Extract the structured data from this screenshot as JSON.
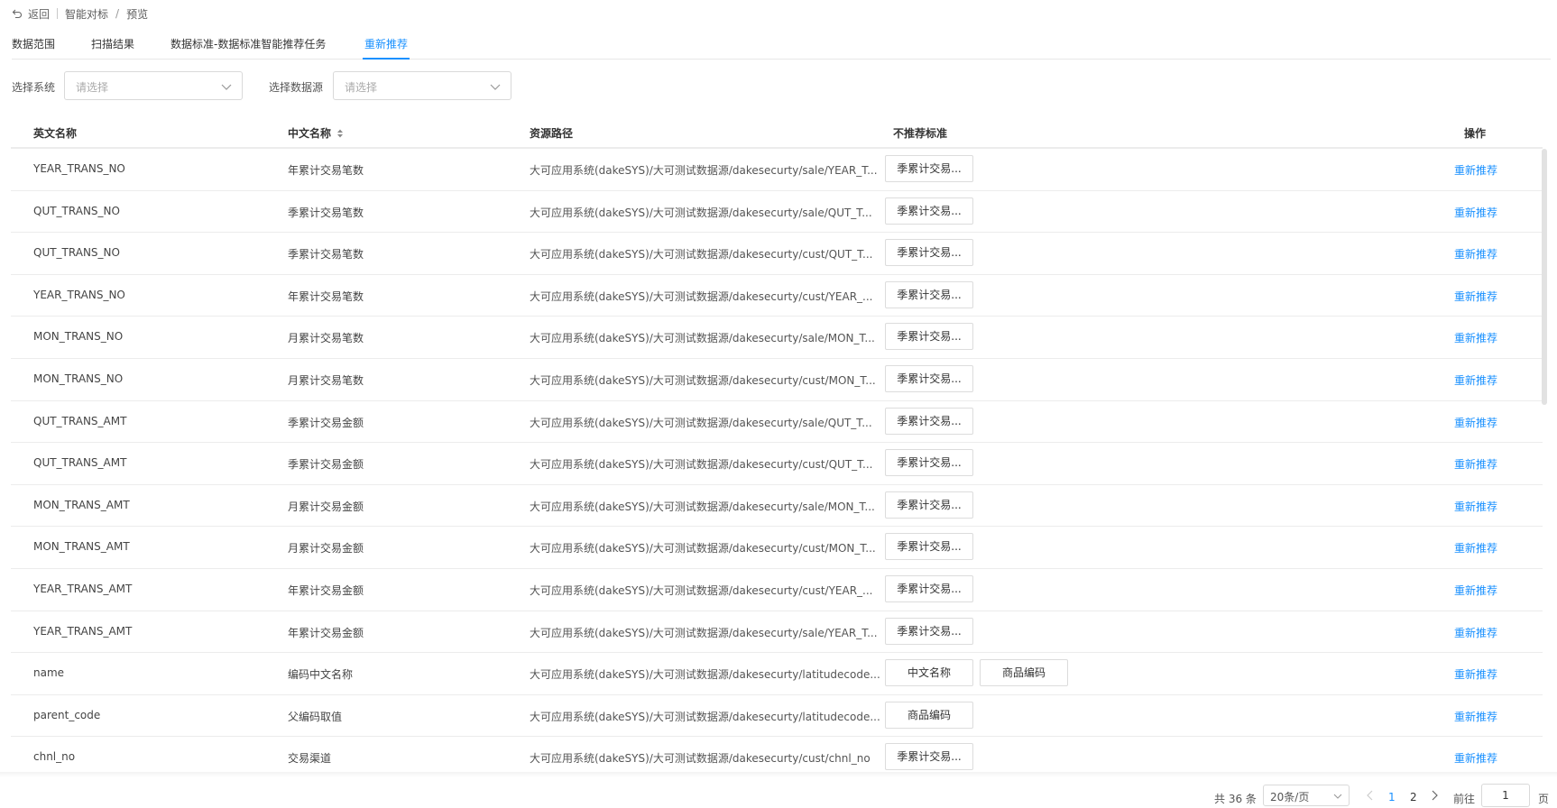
{
  "breadcrumb": {
    "back_label": "返回",
    "items": [
      "智能对标",
      "预览"
    ],
    "separator": "/"
  },
  "tabs": [
    {
      "label": "数据范围",
      "active": false
    },
    {
      "label": "扫描结果",
      "active": false
    },
    {
      "label": "数据标准-数据标准智能推荐任务",
      "active": false
    },
    {
      "label": "重新推荐",
      "active": true
    }
  ],
  "filters": {
    "system": {
      "label": "选择系统",
      "placeholder": "请选择"
    },
    "datasource": {
      "label": "选择数据源",
      "placeholder": "请选择"
    }
  },
  "table": {
    "columns": [
      "英文名称",
      "中文名称",
      "资源路径",
      "不推荐标准",
      "操作"
    ],
    "rows": [
      {
        "en": "YEAR_TRANS_NO",
        "cn": "年累计交易笔数",
        "path": "大可应用系统(dakeSYS)/大可测试数据源/dakesecurty/sale/YEAR_T...",
        "tags": [
          "季累计交易..."
        ],
        "op": "重新推荐"
      },
      {
        "en": "QUT_TRANS_NO",
        "cn": "季累计交易笔数",
        "path": "大可应用系统(dakeSYS)/大可测试数据源/dakesecurty/sale/QUT_T...",
        "tags": [
          "季累计交易..."
        ],
        "op": "重新推荐"
      },
      {
        "en": "QUT_TRANS_NO",
        "cn": "季累计交易笔数",
        "path": "大可应用系统(dakeSYS)/大可测试数据源/dakesecurty/cust/QUT_T...",
        "tags": [
          "季累计交易..."
        ],
        "op": "重新推荐"
      },
      {
        "en": "YEAR_TRANS_NO",
        "cn": "年累计交易笔数",
        "path": "大可应用系统(dakeSYS)/大可测试数据源/dakesecurty/cust/YEAR_...",
        "tags": [
          "季累计交易..."
        ],
        "op": "重新推荐"
      },
      {
        "en": "MON_TRANS_NO",
        "cn": "月累计交易笔数",
        "path": "大可应用系统(dakeSYS)/大可测试数据源/dakesecurty/sale/MON_T...",
        "tags": [
          "季累计交易..."
        ],
        "op": "重新推荐"
      },
      {
        "en": "MON_TRANS_NO",
        "cn": "月累计交易笔数",
        "path": "大可应用系统(dakeSYS)/大可测试数据源/dakesecurty/cust/MON_T...",
        "tags": [
          "季累计交易..."
        ],
        "op": "重新推荐"
      },
      {
        "en": "QUT_TRANS_AMT",
        "cn": "季累计交易金额",
        "path": "大可应用系统(dakeSYS)/大可测试数据源/dakesecurty/sale/QUT_T...",
        "tags": [
          "季累计交易..."
        ],
        "op": "重新推荐"
      },
      {
        "en": "QUT_TRANS_AMT",
        "cn": "季累计交易金额",
        "path": "大可应用系统(dakeSYS)/大可测试数据源/dakesecurty/cust/QUT_T...",
        "tags": [
          "季累计交易..."
        ],
        "op": "重新推荐"
      },
      {
        "en": "MON_TRANS_AMT",
        "cn": "月累计交易金额",
        "path": "大可应用系统(dakeSYS)/大可测试数据源/dakesecurty/sale/MON_T...",
        "tags": [
          "季累计交易..."
        ],
        "op": "重新推荐"
      },
      {
        "en": "MON_TRANS_AMT",
        "cn": "月累计交易金额",
        "path": "大可应用系统(dakeSYS)/大可测试数据源/dakesecurty/cust/MON_T...",
        "tags": [
          "季累计交易..."
        ],
        "op": "重新推荐"
      },
      {
        "en": "YEAR_TRANS_AMT",
        "cn": "年累计交易金额",
        "path": "大可应用系统(dakeSYS)/大可测试数据源/dakesecurty/cust/YEAR_...",
        "tags": [
          "季累计交易..."
        ],
        "op": "重新推荐"
      },
      {
        "en": "YEAR_TRANS_AMT",
        "cn": "年累计交易金额",
        "path": "大可应用系统(dakeSYS)/大可测试数据源/dakesecurty/sale/YEAR_T...",
        "tags": [
          "季累计交易..."
        ],
        "op": "重新推荐"
      },
      {
        "en": "name",
        "cn": "编码中文名称",
        "path": "大可应用系统(dakeSYS)/大可测试数据源/dakesecurty/latitudecode...",
        "tags": [
          "中文名称",
          "商品编码"
        ],
        "op": "重新推荐"
      },
      {
        "en": "parent_code",
        "cn": "父编码取值",
        "path": "大可应用系统(dakeSYS)/大可测试数据源/dakesecurty/latitudecode...",
        "tags": [
          "商品编码"
        ],
        "op": "重新推荐"
      },
      {
        "en": "chnl_no",
        "cn": "交易渠道",
        "path": "大可应用系统(dakeSYS)/大可测试数据源/dakesecurty/cust/chnl_no",
        "tags": [
          "季累计交易..."
        ],
        "op": "重新推荐"
      }
    ]
  },
  "pagination": {
    "total_text": "共 36 条",
    "page_size": "20条/页",
    "pages": [
      "1",
      "2"
    ],
    "current_page": "1",
    "goto_label": "前往",
    "goto_value": "1",
    "goto_unit": "页"
  },
  "colors": {
    "accent": "#1890ff",
    "border": "#d9d9d9",
    "row_line": "#ececec"
  }
}
